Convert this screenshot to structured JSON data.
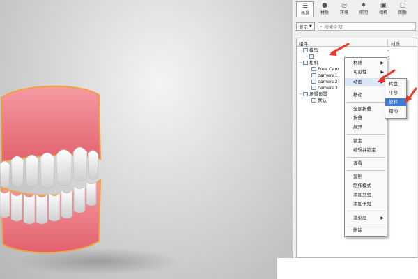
{
  "tabs": [
    {
      "label": "场景",
      "icon": "list-icon"
    },
    {
      "label": "材质",
      "icon": "person-icon"
    },
    {
      "label": "环境",
      "icon": "globe-icon"
    },
    {
      "label": "照明",
      "icon": "bulb-icon"
    },
    {
      "label": "相机",
      "icon": "camera-icon"
    },
    {
      "label": "图像",
      "icon": "image-icon"
    }
  ],
  "toolbar": {
    "display_label": "显示",
    "search_placeholder": "搜索全部"
  },
  "tree": {
    "col_name": "组件",
    "col_material": "材质",
    "rows": [
      {
        "label": "模型",
        "material": "-"
      },
      {
        "label": "",
        "material": "-"
      },
      {
        "label": "相机",
        "material": ""
      },
      {
        "label": "Free Cam",
        "material": ""
      },
      {
        "label": "camera1",
        "material": ""
      },
      {
        "label": "camera2",
        "material": ""
      },
      {
        "label": "camera3",
        "material": ""
      },
      {
        "label": "场景设置",
        "material": ""
      },
      {
        "label": "默认",
        "material": ""
      }
    ]
  },
  "context_menu": {
    "items": [
      "材质",
      "可见性",
      "动画",
      "移动",
      "全部折叠",
      "折叠",
      "展开",
      "锁定",
      "编辑并锁定",
      "查看",
      "复制",
      "制作模式",
      "添加到组",
      "添加子组",
      "渲染层",
      "删除"
    ]
  },
  "submenu": {
    "items": [
      "转盘",
      "平移",
      "旋转",
      "摆动"
    ]
  },
  "colors": {
    "selection": "#3a7bd5",
    "arrow": "#e8372b",
    "gum": "#f07f88"
  }
}
